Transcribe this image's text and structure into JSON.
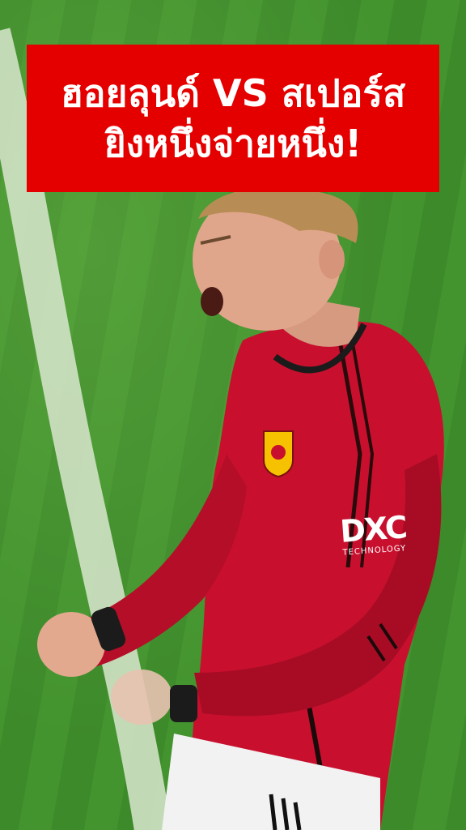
{
  "headline": {
    "line1": "ฮอยลุนด์ VS สเปอร์ส",
    "line2": "ยิงหนึ่งจ่ายหนึ่ง!"
  },
  "colors": {
    "headline_bg": "#e50000",
    "headline_text": "#ffffff",
    "kit_red": "#c8102e",
    "pitch_green": "#3f8a2c"
  },
  "jersey": {
    "sponsor_text": "DXC",
    "sponsor_subtext": "TECHNOLOGY",
    "crest_icon": "club-crest-icon"
  }
}
